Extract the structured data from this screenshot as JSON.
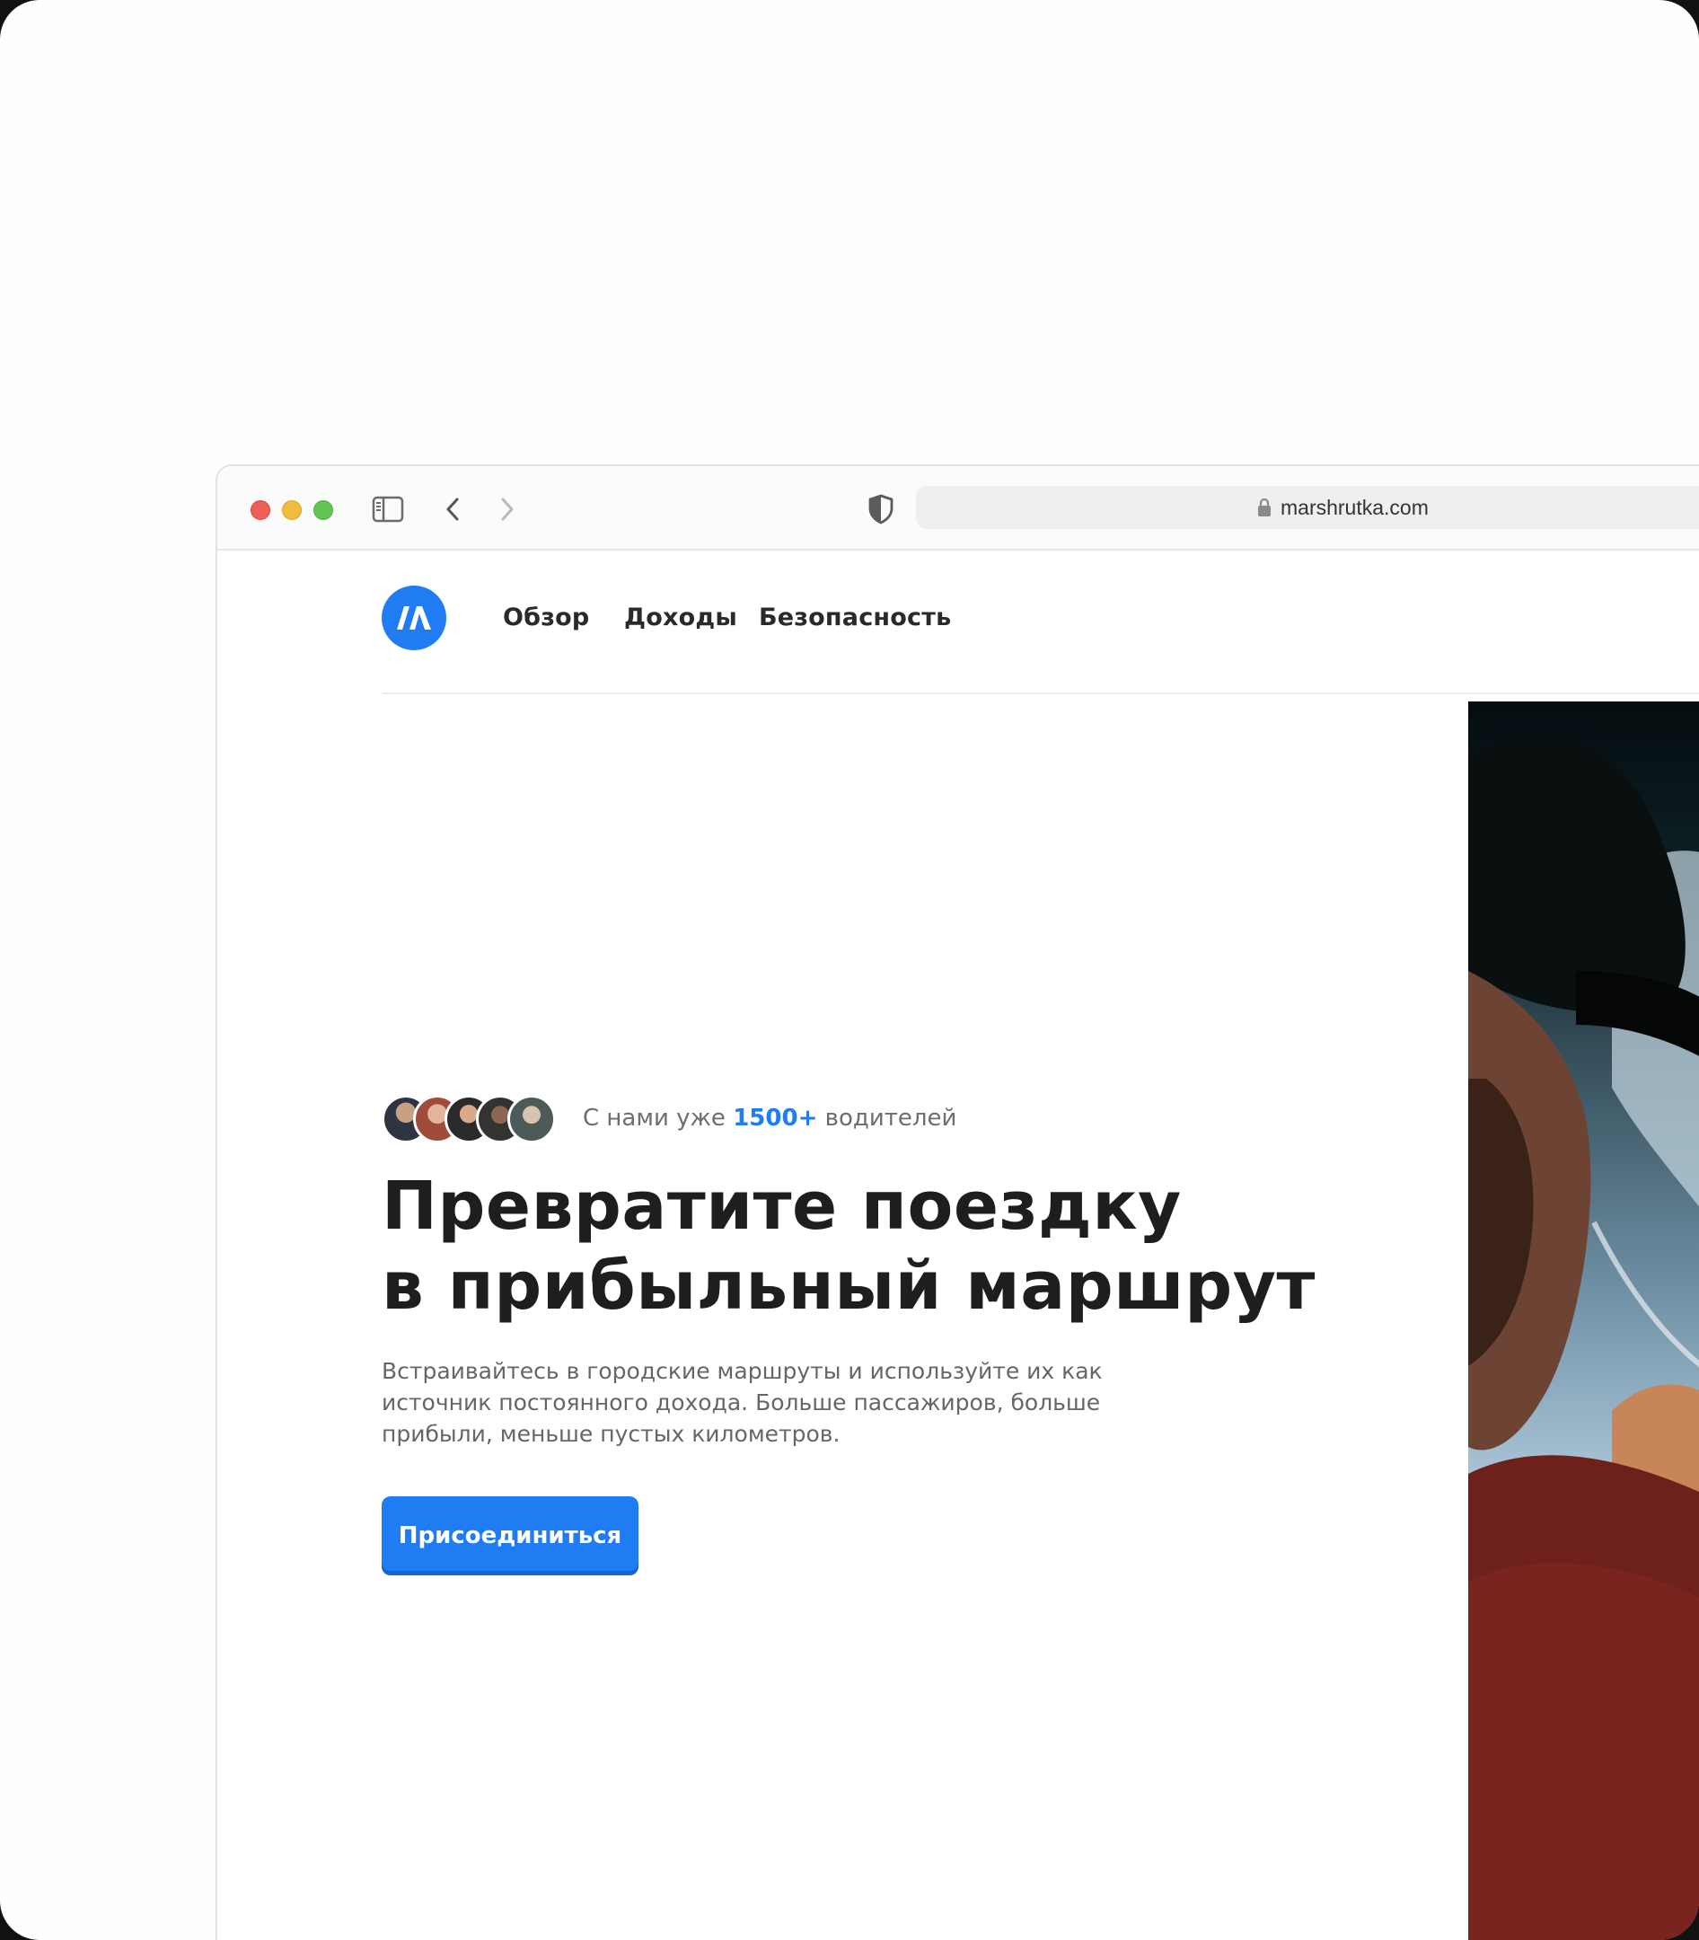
{
  "browser": {
    "url": "marshrutka.com"
  },
  "site": {
    "logo_text": "ⅠΛ",
    "nav": [
      "Обзор",
      "Доходы",
      "Безопасность"
    ]
  },
  "hero": {
    "social_prefix": "С нами уже",
    "social_count": "1500+",
    "social_suffix": "водителей",
    "headline_line1": "Превратите поездку",
    "headline_line2": "в прибыльный маршрут",
    "subtext": "Встраивайтесь в городские маршруты и используйте их как источник постоянного дохода. Больше пассажиров, больше прибыли, меньше пустых километров.",
    "cta_label": "Присоединиться"
  },
  "colors": {
    "accent": "#1f7cf2",
    "heading": "#1e1e1e",
    "body_text": "#666666"
  },
  "icons": [
    "sidebar-icon",
    "back-chevron-icon",
    "forward-chevron-icon",
    "shield-icon",
    "lock-icon"
  ]
}
